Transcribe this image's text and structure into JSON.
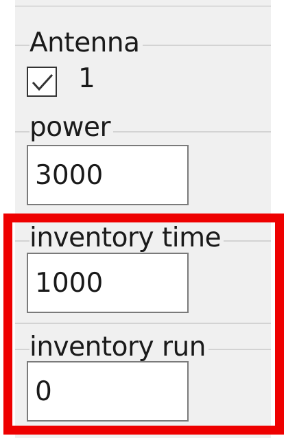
{
  "antenna": {
    "label": "Antenna",
    "checkbox_checked": true,
    "checkbox_label": "1"
  },
  "power": {
    "label": "power",
    "value": "3000"
  },
  "inventory_time": {
    "label": "inventory time",
    "value": "1000"
  },
  "inventory_run": {
    "label": "inventory run",
    "value": "0"
  },
  "highlight": {
    "color": "#ee0000"
  }
}
